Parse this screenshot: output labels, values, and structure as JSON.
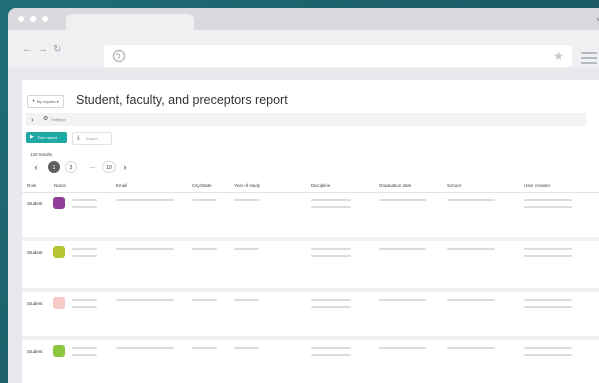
{
  "browser": {
    "tab_title": "",
    "address": "",
    "icons": {
      "back": "arrow-left-icon",
      "forward": "arrow-right-icon",
      "reload": "reload-icon",
      "site": "globe-icon",
      "bookmark": "star-icon",
      "menu": "hamburger-icon",
      "expand": "expand-icon"
    }
  },
  "report": {
    "my_reports_label": "My reports",
    "title": "Student, faculty, and preceptors report",
    "settings_label": "Settings",
    "run_label": "Run report",
    "export_label": "Export",
    "results_text": "120 results",
    "pagination": {
      "prev": "‹",
      "pages": [
        "1",
        "2"
      ],
      "ellipsis": "...",
      "last": "10",
      "next": "›",
      "current": "1"
    },
    "columns": [
      "Role",
      "Name",
      "Email",
      "City/State",
      "Year of study",
      "Discipline",
      "Graduation date",
      "School",
      "User created"
    ],
    "rows": [
      {
        "role": "Student",
        "avatar_color": "#8e3d99"
      },
      {
        "role": "Student",
        "avatar_color": "#b6c632"
      },
      {
        "role": "Student",
        "avatar_color": "#f7c9c4"
      },
      {
        "role": "Student",
        "avatar_color": "#8cc63f"
      }
    ]
  },
  "colors": {
    "accent": "#1fa9a5",
    "background": "#1b5e6a"
  }
}
